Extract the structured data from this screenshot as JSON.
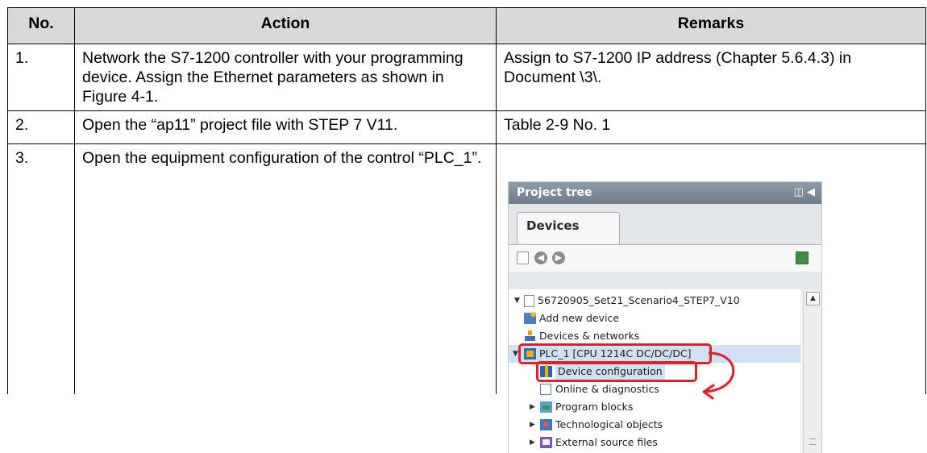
{
  "table": {
    "headers": {
      "no": "No.",
      "action": "Action",
      "remarks": "Remarks"
    },
    "rows": [
      {
        "no": "1.",
        "action": "Network the S7-1200 controller with your programming device. Assign the Ethernet parameters as shown in Figure 4-1.",
        "remarks": "Assign to S7-1200 IP address  (Chapter 5.6.4.3) in Document \\3\\."
      },
      {
        "no": "2.",
        "action": "Open the “ap11” project file with STEP 7 V11.",
        "remarks": "Table 2-9 No. 1"
      },
      {
        "no": "3.",
        "action": "Open the equipment configuration of the control “PLC_1”.",
        "remarks": ""
      }
    ]
  },
  "screenshot": {
    "title": "Project tree",
    "tab": "Devices",
    "tree": {
      "project": "56720905_Set21_Scenario4_STEP7_V10",
      "items": [
        {
          "label": "Add new device",
          "icon": "add-device-icon"
        },
        {
          "label": "Devices & networks",
          "icon": "network-icon"
        },
        {
          "label": "PLC_1 [CPU 1214C DC/DC/DC]",
          "icon": "plc-icon"
        },
        {
          "label": "Device configuration",
          "icon": "device-config-icon"
        },
        {
          "label": "Online & diagnostics",
          "icon": "diagnostics-icon"
        },
        {
          "label": "Program blocks",
          "icon": "program-blocks-icon"
        },
        {
          "label": "Technological objects",
          "icon": "technology-icon"
        },
        {
          "label": "External source files",
          "icon": "external-files-icon"
        }
      ]
    },
    "highlight_color": "#e3202a"
  }
}
